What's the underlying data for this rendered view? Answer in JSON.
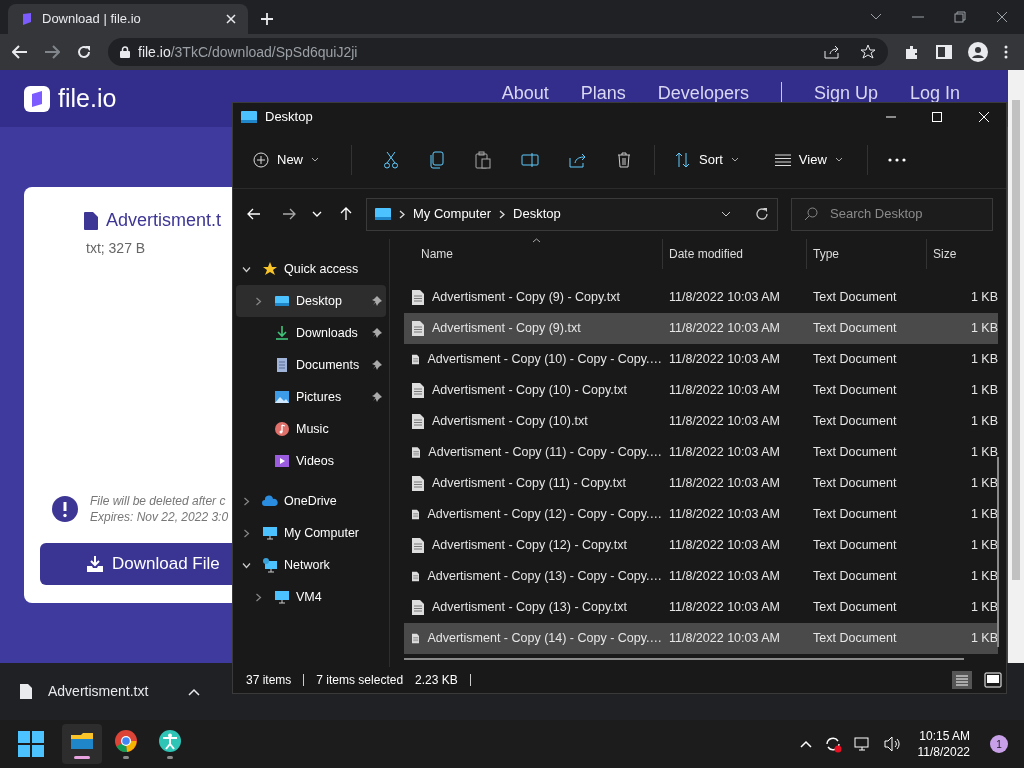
{
  "browser": {
    "tab": {
      "title": "Download | file.io"
    },
    "url": {
      "host": "file.io",
      "path": "/3TkC/download/SpSd6quiJ2ji"
    }
  },
  "site": {
    "logo": "file.io",
    "nav": [
      "About",
      "Plans",
      "Developers",
      "Sign Up",
      "Log In"
    ],
    "file": {
      "name": "Advertisment.t",
      "meta": "txt; 327 B"
    },
    "notice": [
      "File will be deleted after c",
      "Expires: Nov 22, 2022 3:0"
    ],
    "download_button": "Download File"
  },
  "download_bar": {
    "file": "Advertisment.txt"
  },
  "explorer": {
    "title": "Desktop",
    "toolbar": {
      "new": "New",
      "sort": "Sort",
      "view": "View"
    },
    "address": {
      "crumbs": [
        "My Computer",
        "Desktop"
      ],
      "search_placeholder": "Search Desktop"
    },
    "nav": [
      {
        "label": "Quick access",
        "kind": "star",
        "expanded": true,
        "selected": false,
        "children": [
          {
            "label": "Desktop",
            "kind": "desktop",
            "expanded": false,
            "pinned": true,
            "selected": true
          },
          {
            "label": "Downloads",
            "kind": "downloads",
            "pinned": true,
            "selected": false
          },
          {
            "label": "Documents",
            "kind": "documents",
            "pinned": true,
            "selected": false
          },
          {
            "label": "Pictures",
            "kind": "pictures",
            "pinned": true,
            "selected": false
          },
          {
            "label": "Music",
            "kind": "music",
            "pinned": false,
            "selected": false
          },
          {
            "label": "Videos",
            "kind": "videos",
            "pinned": false,
            "selected": false
          }
        ]
      },
      {
        "label": "OneDrive",
        "kind": "cloud",
        "expanded": false,
        "selected": false
      },
      {
        "label": "My Computer",
        "kind": "computer",
        "expanded": false,
        "selected": false
      },
      {
        "label": "Network",
        "kind": "network",
        "expanded": true,
        "selected": false,
        "children": [
          {
            "label": "VM4",
            "kind": "computer",
            "expanded": false,
            "selected": false
          }
        ]
      }
    ],
    "columns": [
      "Name",
      "Date modified",
      "Type",
      "Size"
    ],
    "rows": [
      {
        "name": "Advertisment - Copy (9) - Copy.txt",
        "date": "11/8/2022 10:03 AM",
        "type": "Text Document",
        "size": "1 KB",
        "selected": false
      },
      {
        "name": "Advertisment - Copy (9).txt",
        "date": "11/8/2022 10:03 AM",
        "type": "Text Document",
        "size": "1 KB",
        "selected": true
      },
      {
        "name": "Advertisment - Copy (10) - Copy - Copy.…",
        "date": "11/8/2022 10:03 AM",
        "type": "Text Document",
        "size": "1 KB",
        "selected": false
      },
      {
        "name": "Advertisment - Copy (10) - Copy.txt",
        "date": "11/8/2022 10:03 AM",
        "type": "Text Document",
        "size": "1 KB",
        "selected": false
      },
      {
        "name": "Advertisment - Copy (10).txt",
        "date": "11/8/2022 10:03 AM",
        "type": "Text Document",
        "size": "1 KB",
        "selected": false
      },
      {
        "name": "Advertisment - Copy (11) - Copy - Copy.…",
        "date": "11/8/2022 10:03 AM",
        "type": "Text Document",
        "size": "1 KB",
        "selected": false
      },
      {
        "name": "Advertisment - Copy (11) - Copy.txt",
        "date": "11/8/2022 10:03 AM",
        "type": "Text Document",
        "size": "1 KB",
        "selected": false
      },
      {
        "name": "Advertisment - Copy (12) - Copy - Copy.…",
        "date": "11/8/2022 10:03 AM",
        "type": "Text Document",
        "size": "1 KB",
        "selected": false
      },
      {
        "name": "Advertisment - Copy (12) - Copy.txt",
        "date": "11/8/2022 10:03 AM",
        "type": "Text Document",
        "size": "1 KB",
        "selected": false
      },
      {
        "name": "Advertisment - Copy (13) - Copy - Copy.…",
        "date": "11/8/2022 10:03 AM",
        "type": "Text Document",
        "size": "1 KB",
        "selected": false
      },
      {
        "name": "Advertisment - Copy (13) - Copy.txt",
        "date": "11/8/2022 10:03 AM",
        "type": "Text Document",
        "size": "1 KB",
        "selected": false
      },
      {
        "name": "Advertisment - Copy (14) - Copy - Copy.…",
        "date": "11/8/2022 10:03 AM",
        "type": "Text Document",
        "size": "1 KB",
        "selected": true
      }
    ],
    "status": {
      "count": "37 items",
      "selection": "7 items selected",
      "size": "2.23 KB"
    }
  },
  "taskbar": {
    "apps": [
      {
        "kind": "explorer",
        "active": true
      },
      {
        "kind": "chrome",
        "active": false
      },
      {
        "kind": "assist",
        "active": false
      }
    ],
    "time": "10:15 AM",
    "date": "11/8/2022",
    "badge": "1"
  }
}
